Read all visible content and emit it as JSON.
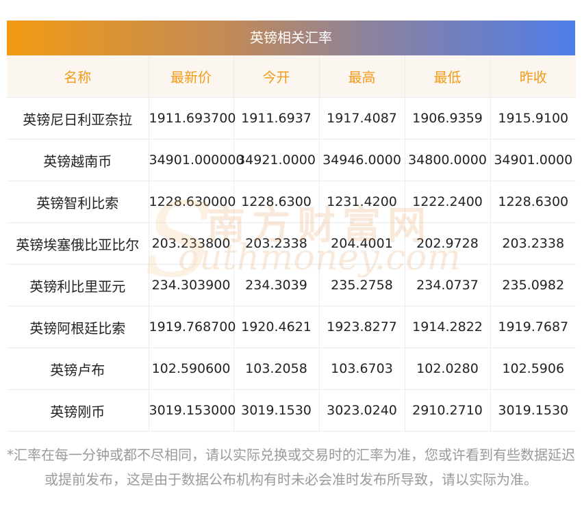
{
  "title": "英镑相关汇率",
  "headers": [
    "名称",
    "最新价",
    "今开",
    "最高",
    "最低",
    "昨收"
  ],
  "rows": [
    [
      "英镑尼日利亚奈拉",
      "1911.693700",
      "1911.6937",
      "1917.4087",
      "1906.9359",
      "1915.9100"
    ],
    [
      "英镑越南币",
      "34901.000000",
      "34921.0000",
      "34946.0000",
      "34800.0000",
      "34901.0000"
    ],
    [
      "英镑智利比索",
      "1228.630000",
      "1228.6300",
      "1231.4200",
      "1222.2400",
      "1228.6300"
    ],
    [
      "英镑埃塞俄比亚比尔",
      "203.233800",
      "203.2338",
      "204.4001",
      "202.9728",
      "203.2338"
    ],
    [
      "英镑利比里亚元",
      "234.303900",
      "234.3039",
      "235.2758",
      "234.0737",
      "235.0982"
    ],
    [
      "英镑阿根廷比索",
      "1919.768700",
      "1920.4621",
      "1923.8277",
      "1914.2822",
      "1919.7687"
    ],
    [
      "英镑卢布",
      "102.590600",
      "103.2058",
      "103.6703",
      "102.0280",
      "102.5906"
    ],
    [
      "英镑刚币",
      "3019.153000",
      "3019.1530",
      "3023.0240",
      "2910.2710",
      "3019.1530"
    ]
  ],
  "watermark": {
    "cn": "南方财富网",
    "en": "outhmoney.com",
    "letter": "S"
  },
  "note": "*汇率在每一分钟或都不尽相同，请以实际兑换或交易时的汇率为准，您或许看到有些数据延迟或提前发布，这是由于数据公布机构有时未必会准时发布所导致，请以实际为准。",
  "colors": {
    "accent_orange": "#f29b1a",
    "gradient_start": "#f39a14",
    "gradient_end": "#4f7de8",
    "header_bg": "#fbf6ef"
  }
}
